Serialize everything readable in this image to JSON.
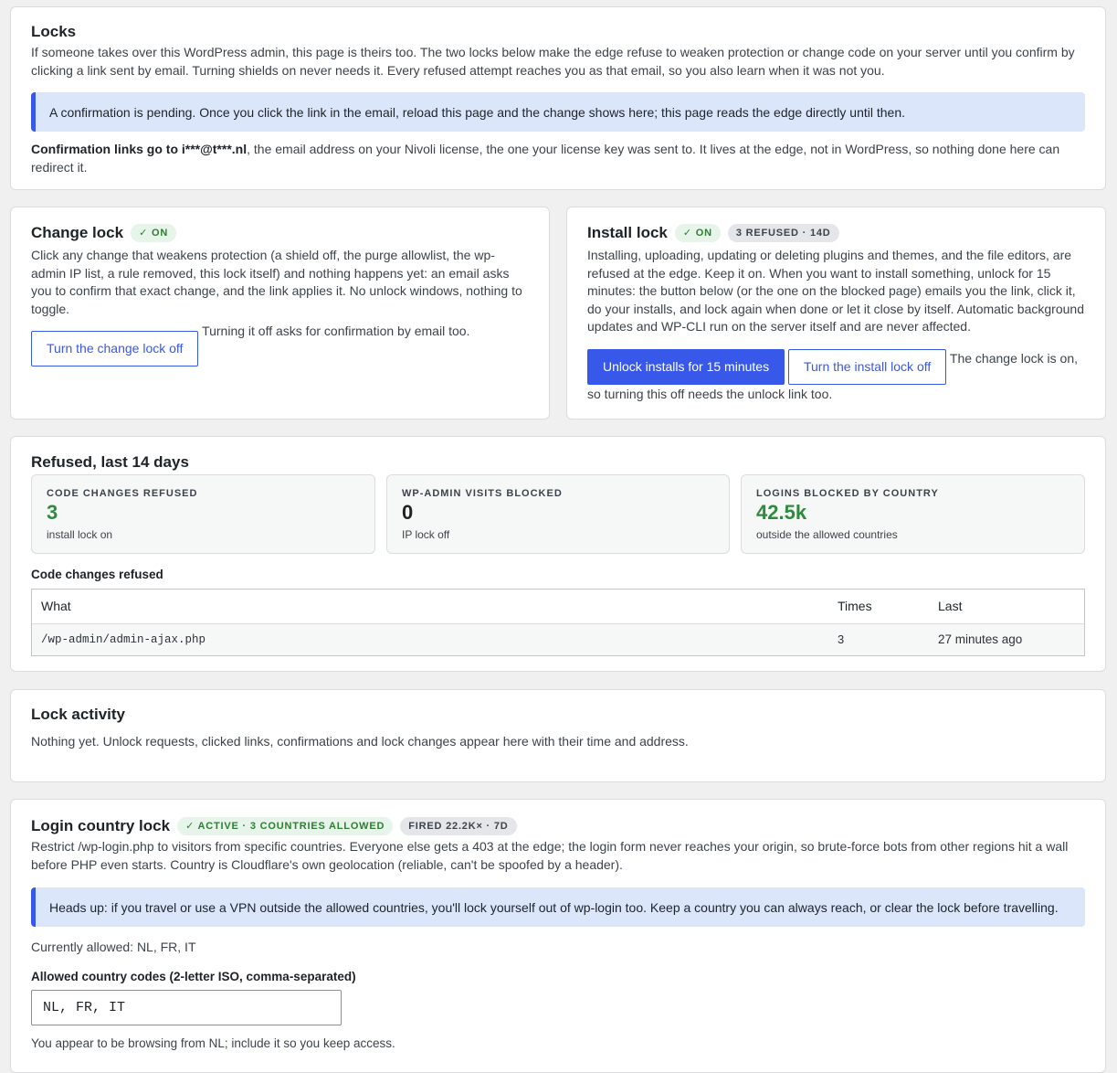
{
  "locks": {
    "title": "Locks",
    "intro": "If someone takes over this WordPress admin, this page is theirs too. The two locks below make the edge refuse to weaken protection or change code on your server until you confirm by clicking a link sent by email. Turning shields on never needs it. Every refused attempt reaches you as that email, so you also learn when it was not you.",
    "pending_notice": "A confirmation is pending. Once you click the link in the email, reload this page and the change shows here; this page reads the edge directly until then.",
    "confirm_prefix": "Confirmation links go to i***@t***.nl",
    "confirm_rest": ", the email address on your Nivoli license, the one your license key was sent to. It lives at the edge, not in WordPress, so nothing done here can redirect it."
  },
  "change_lock": {
    "title": "Change lock",
    "badge": "✓ ON",
    "description": "Click any change that weakens protection (a shield off, the purge allowlist, the wp-admin IP list, a rule removed, this lock itself) and nothing happens yet: an email asks you to confirm that exact change, and the link applies it. No unlock windows, nothing to toggle.",
    "button": "Turn the change lock off",
    "button_note": "Turning it off asks for confirmation by email too."
  },
  "install_lock": {
    "title": "Install lock",
    "badge": "✓ ON",
    "refused_badge": "3 REFUSED · 14D",
    "description": "Installing, uploading, updating or deleting plugins and themes, and the file editors, are refused at the edge. Keep it on. When you want to install something, unlock for 15 minutes: the button below (or the one on the blocked page) emails you the link, click it, do your installs, and lock again when done or let it close by itself. Automatic background updates and WP-CLI run on the server itself and are never affected.",
    "unlock_button": "Unlock installs for 15 minutes",
    "off_button": "Turn the install lock off",
    "note": "The change lock is on, so turning this off needs the unlock link too."
  },
  "refused": {
    "title": "Refused, last 14 days",
    "stats": [
      {
        "label": "CODE CHANGES REFUSED",
        "value": "3",
        "sub": "install lock on",
        "color": "#2e8b3e"
      },
      {
        "label": "WP-ADMIN VISITS BLOCKED",
        "value": "0",
        "sub": "IP lock off",
        "color": "#1d2327"
      },
      {
        "label": "LOGINS BLOCKED BY COUNTRY",
        "value": "42.5k",
        "sub": "outside the allowed countries",
        "color": "#2e8b3e"
      }
    ],
    "table_title": "Code changes refused",
    "columns": [
      "What",
      "Times",
      "Last"
    ],
    "rows": [
      {
        "what": "/wp-admin/admin-ajax.php",
        "times": "3",
        "last": "27 minutes ago"
      }
    ]
  },
  "activity": {
    "title": "Lock activity",
    "empty": "Nothing yet. Unlock requests, clicked links, confirmations and lock changes appear here with their time and address."
  },
  "country_lock": {
    "title": "Login country lock",
    "badge": "✓ ACTIVE · 3 COUNTRIES ALLOWED",
    "fired_badge": "FIRED 22.2K× · 7D",
    "description": "Restrict /wp-login.php to visitors from specific countries. Everyone else gets a 403 at the edge; the login form never reaches your origin, so brute-force bots from other regions hit a wall before PHP even starts. Country is Cloudflare's own geolocation (reliable, can't be spoofed by a header).",
    "warning": "Heads up: if you travel or use a VPN outside the allowed countries, you'll lock yourself out of wp-login too. Keep a country you can always reach, or clear the lock before travelling.",
    "currently_allowed": "Currently allowed: NL, FR, IT",
    "field_label": "Allowed country codes (2-letter ISO, comma-separated)",
    "field_value": "NL, FR, IT",
    "hint": "You appear to be browsing from NL; include it so you keep access."
  },
  "colors": {
    "accent": "#3858e9",
    "green": "#2e8b3e",
    "notice_bg": "#dbe6fb"
  }
}
